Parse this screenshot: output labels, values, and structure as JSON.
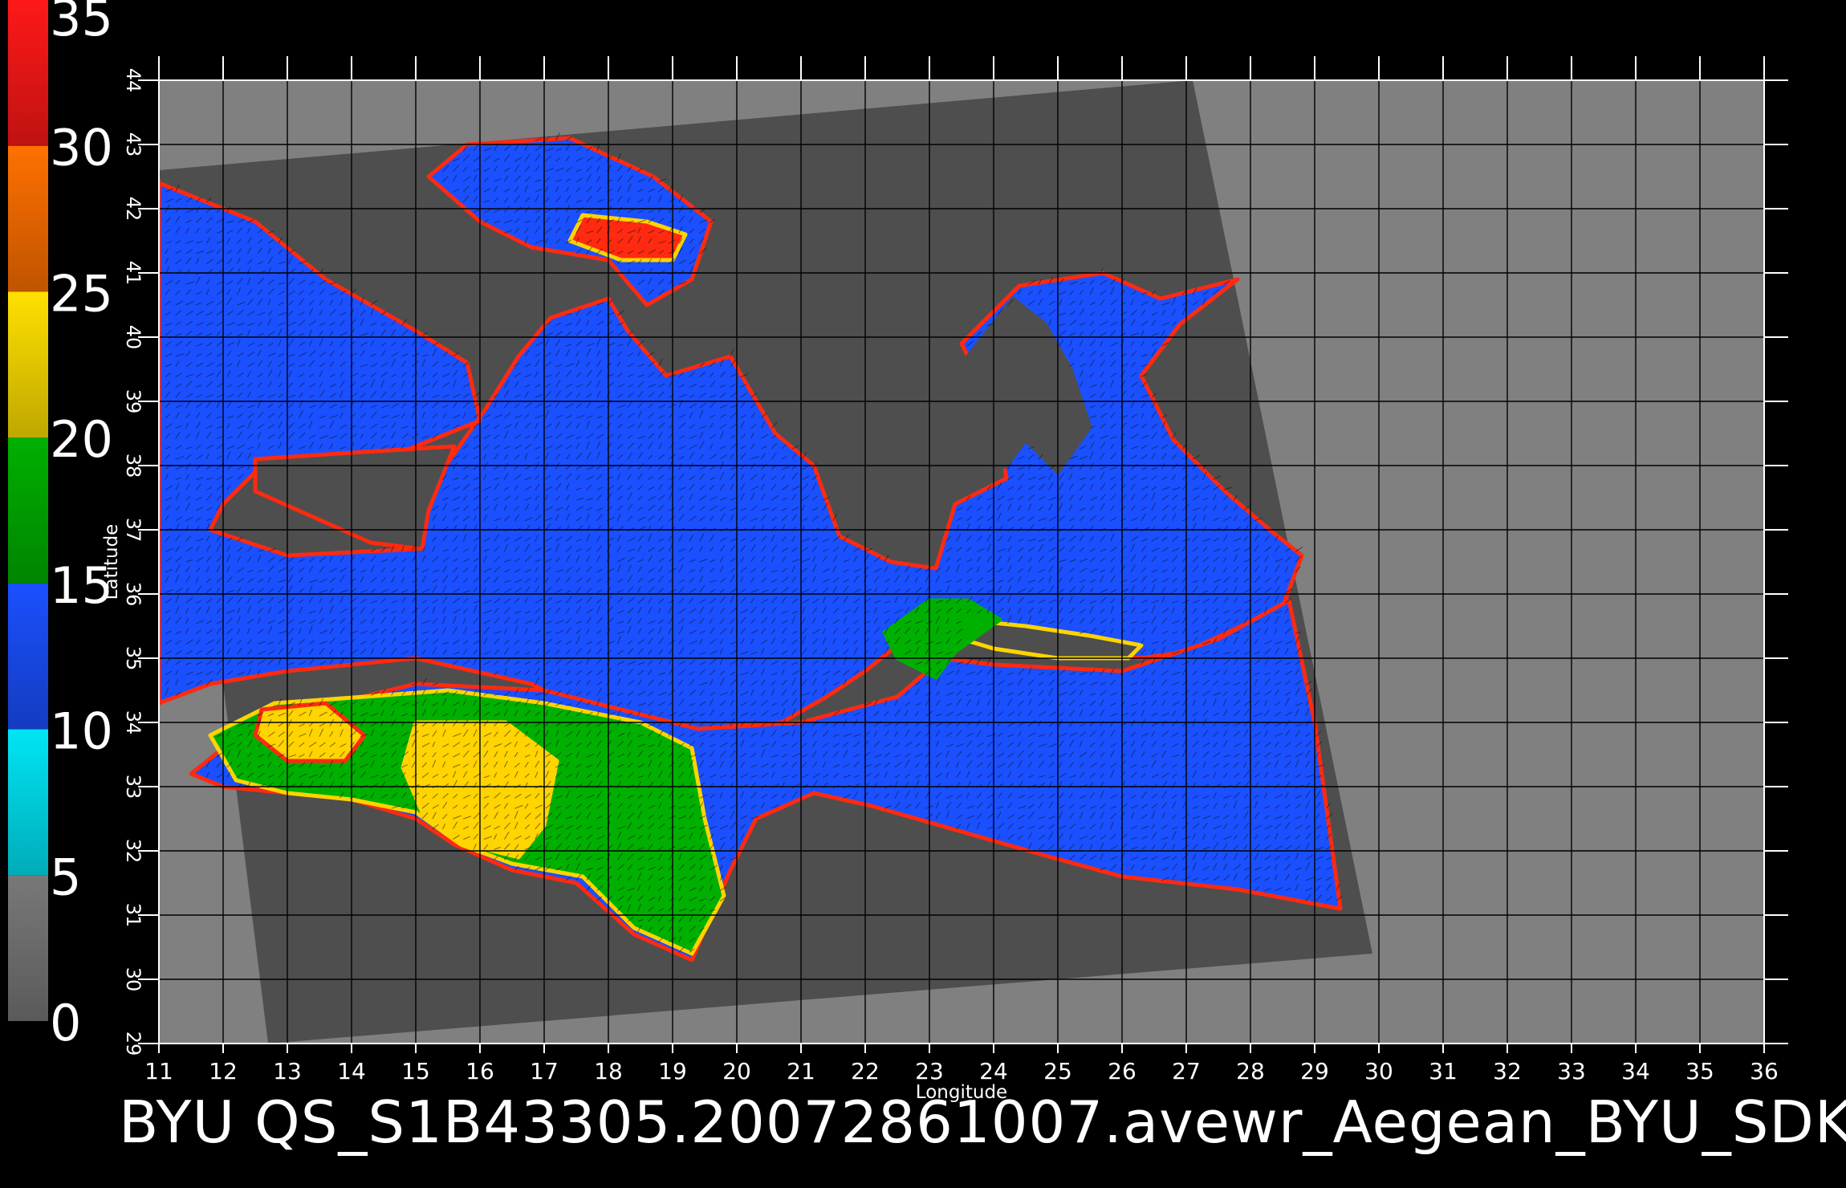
{
  "chart_data": {
    "type": "heatmap",
    "title": "BYU QS_S1B43305.20072861007.avewr_Aegean_BYU_SDK",
    "xlabel": "Longitude",
    "ylabel": "Latitude",
    "xlim": [
      11,
      36
    ],
    "ylim": [
      29,
      44
    ],
    "x_ticks": [
      "11",
      "12",
      "13",
      "14",
      "15",
      "16",
      "17",
      "18",
      "19",
      "20",
      "21",
      "22",
      "23",
      "24",
      "25",
      "26",
      "27",
      "28",
      "29",
      "30",
      "31",
      "32",
      "33",
      "34",
      "35",
      "36"
    ],
    "y_ticks": [
      "29",
      "30",
      "31",
      "32",
      "33",
      "34",
      "35",
      "36",
      "37",
      "38",
      "39",
      "40",
      "41",
      "42",
      "43",
      "44"
    ],
    "grid": true,
    "colorbar": {
      "position": "left",
      "range": [
        0,
        35
      ],
      "tick_labels": [
        "0",
        "5",
        "10",
        "15",
        "20",
        "25",
        "30",
        "35"
      ],
      "segments": [
        {
          "from": 0,
          "to": 5,
          "color": "#787878"
        },
        {
          "from": 5,
          "to": 10,
          "color": "#00e5f5"
        },
        {
          "from": 10,
          "to": 15,
          "color": "#1a50ff"
        },
        {
          "from": 15,
          "to": 20,
          "color": "#00b000"
        },
        {
          "from": 20,
          "to": 25,
          "color": "#ffe000"
        },
        {
          "from": 25,
          "to": 30,
          "color": "#ff7000"
        },
        {
          "from": 30,
          "to": 35,
          "color": "#ff1818"
        }
      ]
    },
    "colors": {
      "no_data": "#808080",
      "land": "#4e4e4e",
      "calm": "#1a50ff",
      "moderate": "#00b000",
      "strong": "#ffd400",
      "gale": "#ff2a10"
    }
  }
}
